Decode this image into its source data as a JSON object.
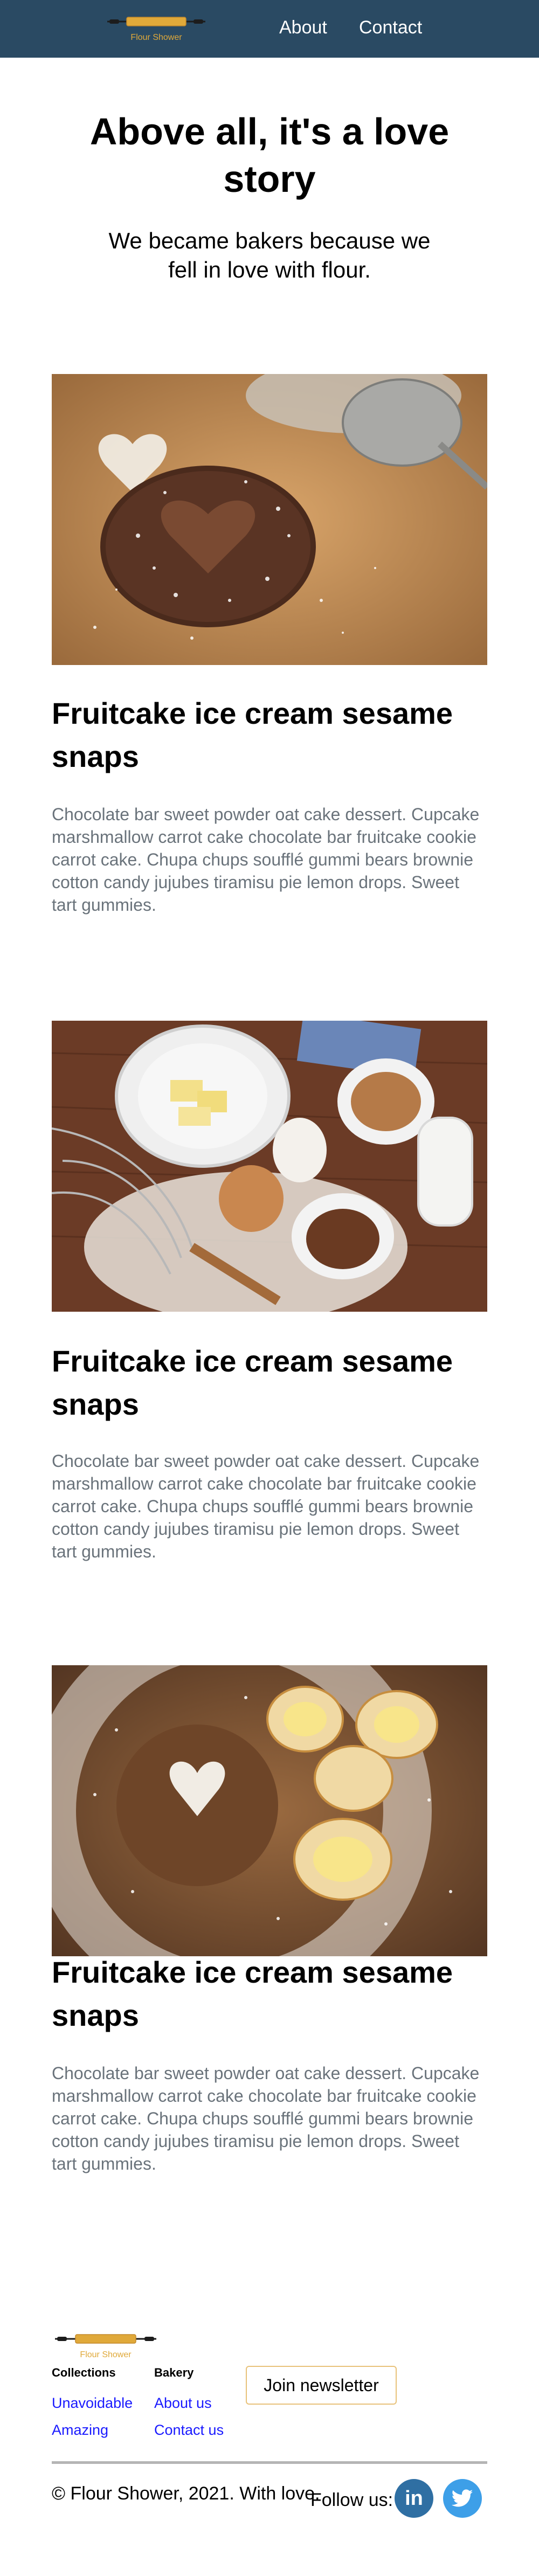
{
  "header": {
    "logo_text": "Flour Shower",
    "nav": [
      {
        "label": "About"
      },
      {
        "label": "Contact"
      }
    ]
  },
  "hero": {
    "title": "Above all, it's a love story",
    "subtitle": "We became bakers because we fell in love with flour."
  },
  "articles": [
    {
      "title": "Fruitcake ice cream sesame snaps",
      "body": "Chocolate bar sweet powder oat cake dessert. Cupcake marshmallow carrot cake chocolate bar fruitcake cookie carrot cake. Chupa chups soufflé gummi bears brownie cotton candy jujubes tiramisu pie lemon drops. Sweet tart gummies."
    },
    {
      "title": "Fruitcake ice cream sesame snaps",
      "body": "Chocolate bar sweet powder oat cake dessert. Cupcake marshmallow carrot cake chocolate bar fruitcake cookie carrot cake. Chupa chups soufflé gummi bears brownie cotton candy jujubes tiramisu pie lemon drops. Sweet tart gummies."
    },
    {
      "title": "Fruitcake ice cream sesame snaps",
      "body": "Chocolate bar sweet powder oat cake dessert. Cupcake marshmallow carrot cake chocolate bar fruitcake cookie carrot cake. Chupa chups soufflé gummi bears brownie cotton candy jujubes tiramisu pie lemon drops. Sweet tart gummies."
    }
  ],
  "footer": {
    "logo_text": "Flour Shower",
    "collections": {
      "title": "Collections",
      "links": [
        "Unavoidable",
        "Amazing"
      ]
    },
    "bakery": {
      "title": "Bakery",
      "links": [
        "About us",
        "Contact us"
      ]
    },
    "newsletter_label": "Join newsletter",
    "copyright": "© Flour Shower, 2021. With love.",
    "follow_label": "Follow us:",
    "social": {
      "linkedin_label": "in"
    }
  },
  "colors": {
    "header_bg": "#2a4a63",
    "logo_gold": "#e0a93a",
    "link_blue": "#1a1aff",
    "body_grey": "#6a737b",
    "linkedin": "#2f6fa3",
    "twitter": "#3d9fe8"
  }
}
